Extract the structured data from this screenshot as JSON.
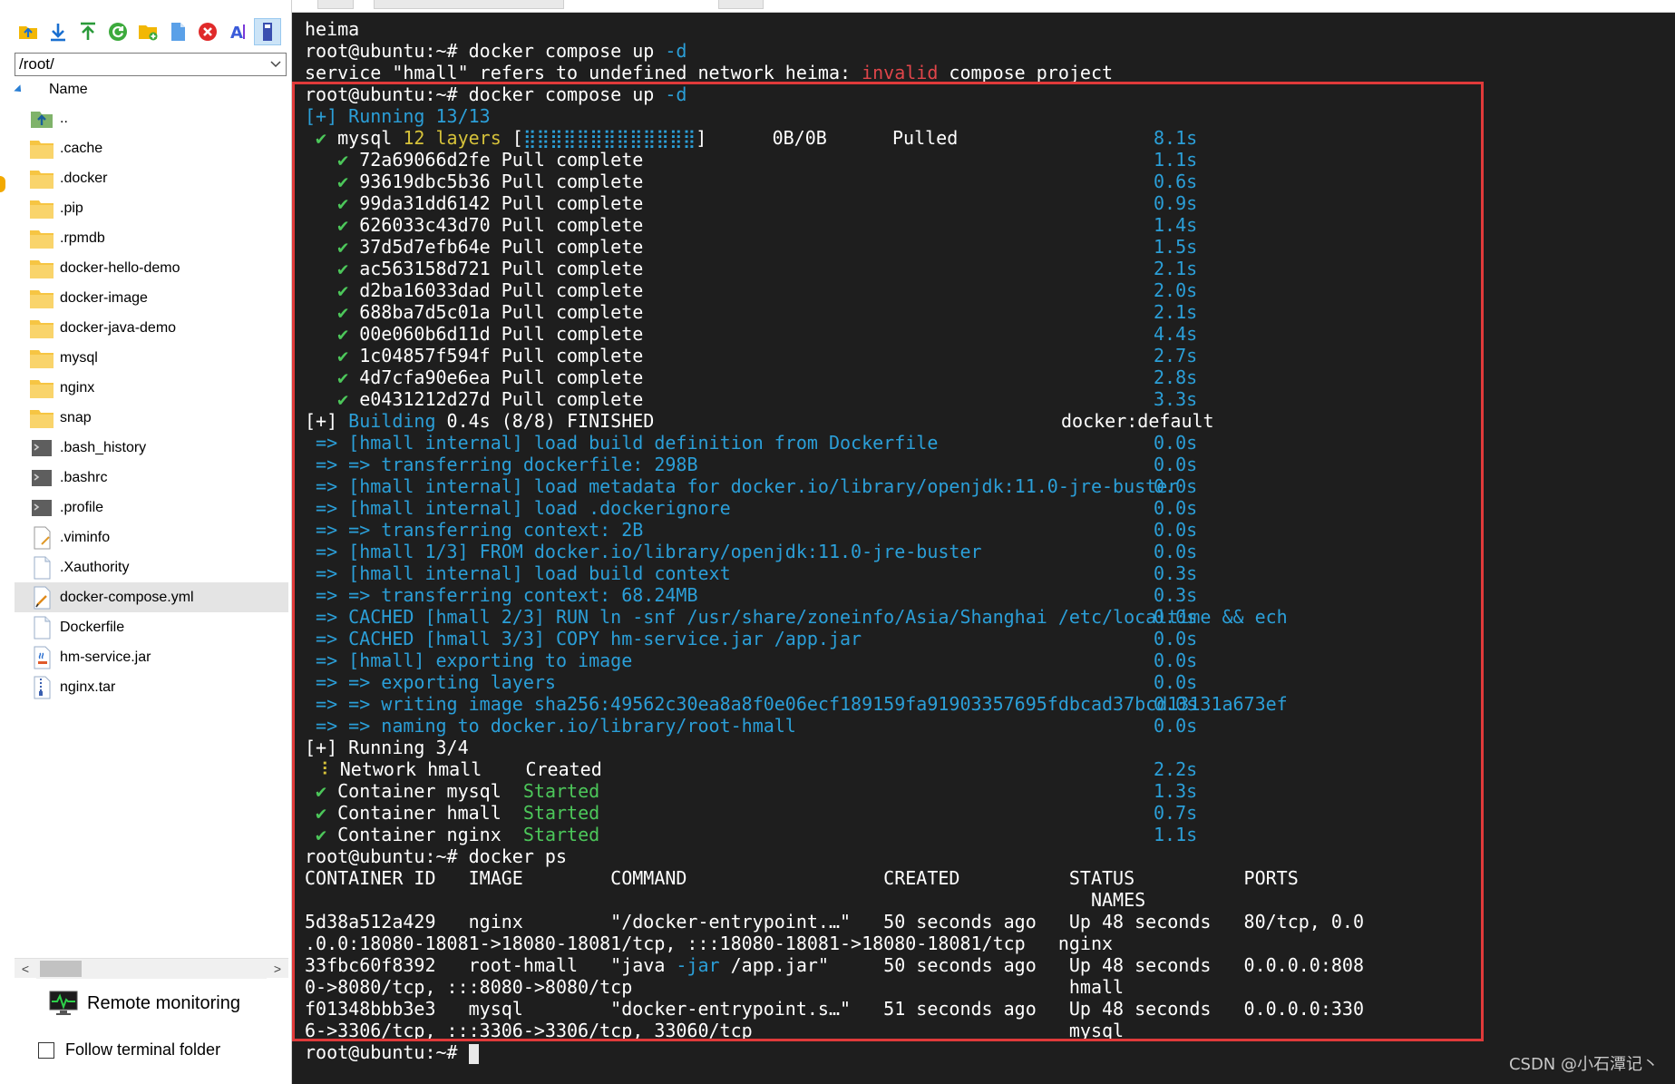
{
  "file_panel": {
    "path": "/root/",
    "column_name": "Name",
    "files": [
      {
        "name": "..",
        "icon": "folder-up-icon"
      },
      {
        "name": ".cache",
        "icon": "folder-icon"
      },
      {
        "name": ".docker",
        "icon": "folder-icon"
      },
      {
        "name": ".pip",
        "icon": "folder-icon"
      },
      {
        "name": ".rpmdb",
        "icon": "folder-icon"
      },
      {
        "name": "docker-hello-demo",
        "icon": "folder-icon"
      },
      {
        "name": "docker-image",
        "icon": "folder-icon"
      },
      {
        "name": "docker-java-demo",
        "icon": "folder-icon"
      },
      {
        "name": "mysql",
        "icon": "folder-icon"
      },
      {
        "name": "nginx",
        "icon": "folder-icon"
      },
      {
        "name": "snap",
        "icon": "folder-icon"
      },
      {
        "name": ".bash_history",
        "icon": "shell-file-icon"
      },
      {
        "name": ".bashrc",
        "icon": "shell-file-icon"
      },
      {
        "name": ".profile",
        "icon": "shell-file-icon"
      },
      {
        "name": ".viminfo",
        "icon": "text-file-icon"
      },
      {
        "name": ".Xauthority",
        "icon": "blank-file-icon"
      },
      {
        "name": "docker-compose.yml",
        "icon": "yml-file-icon"
      },
      {
        "name": "Dockerfile",
        "icon": "blank-file-icon"
      },
      {
        "name": "hm-service.jar",
        "icon": "jar-file-icon"
      },
      {
        "name": "nginx.tar",
        "icon": "archive-file-icon"
      }
    ],
    "selected_index": 16,
    "remote_monitoring_label": "Remote monitoring",
    "follow_terminal_label": "Follow terminal folder"
  },
  "terminal": {
    "prompt": "root@ubuntu:~#",
    "lines": {
      "l01": "heima",
      "l02_cmd": " docker compose up",
      "l02_flag": " -d",
      "l03a": "service \"hmall\" refers to undefined network heima: ",
      "l03b": "invalid",
      "l03c": " compose project",
      "l04_cmd": " docker compose up",
      "l04_flag": " -d",
      "l05": "[+] Running 13/13",
      "l06a": " ✔ ",
      "l06b": "mysql",
      "l06c": " 12 layers ",
      "l06d": "[",
      "l06e": "⣿⣿⣿⣿⣿⣿⣿⣿⣿⣿⣿⣿⣿",
      "l06f": "]      0B/0B      Pulled",
      "l06t": "8.1s",
      "layers": [
        {
          "id": "72a69066d2fe",
          "time": "1.1s"
        },
        {
          "id": "93619dbc5b36",
          "time": "0.6s"
        },
        {
          "id": "99da31dd6142",
          "time": "0.9s"
        },
        {
          "id": "626033c43d70",
          "time": "1.4s"
        },
        {
          "id": "37d5d7efb64e",
          "time": "1.5s"
        },
        {
          "id": "ac563158d721",
          "time": "2.1s"
        },
        {
          "id": "d2ba16033dad",
          "time": "2.0s"
        },
        {
          "id": "688ba7d5c01a",
          "time": "2.1s"
        },
        {
          "id": "00e060b6d11d",
          "time": "4.4s"
        },
        {
          "id": "1c04857f594f",
          "time": "2.7s"
        },
        {
          "id": "4d7cfa90e6ea",
          "time": "2.8s"
        },
        {
          "id": "e0431212d27d",
          "time": "3.3s"
        }
      ],
      "pull_complete": "Pull complete",
      "check": "✔",
      "build_a": "[+] ",
      "build_b": "Building",
      "build_c": " 0.4s (8/8) FINISHED",
      "build_r": "docker:default",
      "build_steps": [
        {
          "text": "=> [hmall internal] load build definition from Dockerfile",
          "time": "0.0s"
        },
        {
          "text": "=> => transferring dockerfile: 298B",
          "time": "0.0s"
        },
        {
          "text": "=> [hmall internal] load metadata for docker.io/library/openjdk:11.0-jre-buster",
          "time": "0.0s"
        },
        {
          "text": "=> [hmall internal] load .dockerignore",
          "time": "0.0s"
        },
        {
          "text": "=> => transferring context: 2B",
          "time": "0.0s"
        },
        {
          "text": "=> [hmall 1/3] FROM docker.io/library/openjdk:11.0-jre-buster",
          "time": "0.0s"
        },
        {
          "text": "=> [hmall internal] load build context",
          "time": "0.3s"
        },
        {
          "text": "=> => transferring context: 68.24MB",
          "time": "0.3s"
        },
        {
          "text": "=> CACHED [hmall 2/3] RUN ln -snf /usr/share/zoneinfo/Asia/Shanghai /etc/localtime && ech",
          "time": "0.0s"
        },
        {
          "text": "=> CACHED [hmall 3/3] COPY hm-service.jar /app.jar",
          "time": "0.0s"
        },
        {
          "text": "=> [hmall] exporting to image",
          "time": "0.0s"
        },
        {
          "text": "=> => exporting layers",
          "time": "0.0s"
        },
        {
          "text": "=> => writing image sha256:49562c30ea8a8f0e06ecf189159fa91903357695fdbcad37bcd13131a673ef",
          "time": "0.0s"
        },
        {
          "text": "=> => naming to docker.io/library/root-hmall",
          "time": "0.0s"
        }
      ],
      "running2": "[+] Running 3/4",
      "net_mark": "⠸",
      "net_a": "Network hmall",
      "net_b": "Created",
      "net_t": "2.2s",
      "containers": [
        {
          "name": "Container mysql",
          "state": "Started",
          "time": "1.3s"
        },
        {
          "name": "Container hmall",
          "state": "Started",
          "time": "0.7s"
        },
        {
          "name": "Container nginx",
          "state": "Started",
          "time": "1.1s"
        }
      ],
      "ps_cmd": " docker ps",
      "ps_h1": "CONTAINER ID   IMAGE        COMMAND                  CREATED          STATUS          PORTS",
      "ps_h2": "                                                                        NAMES",
      "ps_r1": "5d38a512a429   nginx        \"/docker-entrypoint.…\"   50 seconds ago   Up 48 seconds   80/tcp, 0.0",
      "ps_r1b": ".0.0:18080-18081->18080-18081/tcp, :::18080-18081->18080-18081/tcp   nginx",
      "ps_r2a": "33fbc60f8392   root-hmall   \"java ",
      "ps_r2b": "-jar",
      "ps_r2c": " /app.jar\"     50 seconds ago   Up 48 seconds   0.0.0.0:808",
      "ps_r2d": "0->8080/tcp, :::8080->8080/tcp                                        hmall",
      "ps_r3": "f01348bbb3e3   mysql        \"docker-entrypoint.s…\"   51 seconds ago   Up 48 seconds   0.0.0.0:330",
      "ps_r3b": "6->3306/tcp, :::3306->3306/tcp, 33060/tcp                             mysql"
    }
  },
  "watermark": "CSDN @小石潭记丶",
  "colors": {
    "terminal_bg": "#1e1e1e",
    "highlight_frame": "#e03a3a",
    "blue": "#2b9fd8",
    "green": "#4cc75a",
    "yellow": "#d6c23a",
    "red": "#e0454a"
  }
}
